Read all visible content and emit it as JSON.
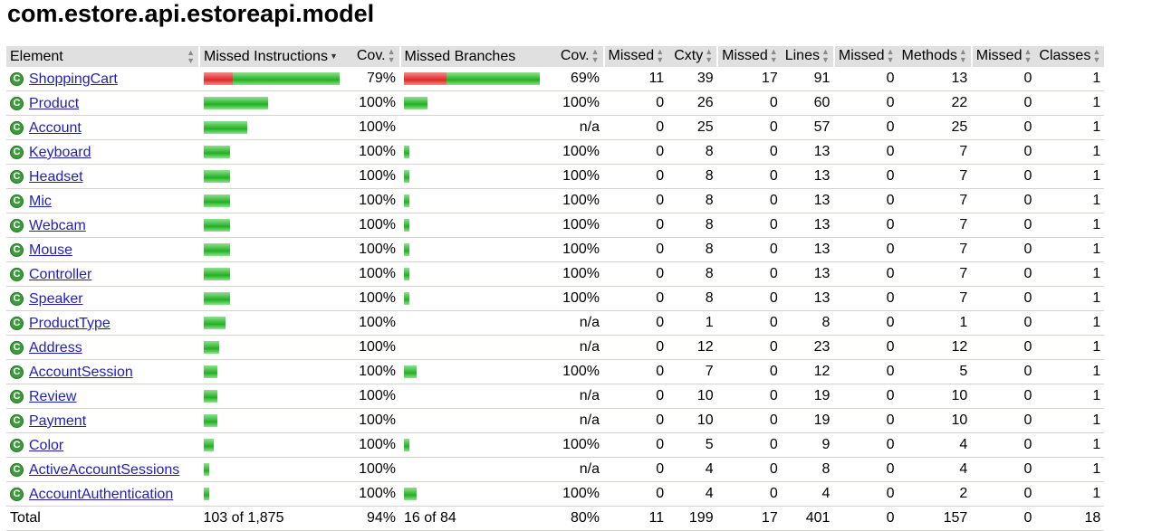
{
  "title": "com.estore.api.estoreapi.model",
  "headers": {
    "element": "Element",
    "missed_instructions": "Missed Instructions",
    "cov1": "Cov.",
    "missed_branches": "Missed Branches",
    "cov2": "Cov.",
    "missed_cxty": "Missed",
    "cxty": "Cxty",
    "missed_lines": "Missed",
    "lines": "Lines",
    "missed_methods": "Missed",
    "methods": "Methods",
    "missed_classes": "Missed",
    "classes": "Classes"
  },
  "colors": {
    "missed_bar": "#e02828",
    "covered_bar": "#22b022",
    "header_bg": "#e0e0e0",
    "class_icon": "#3d9a3d"
  },
  "rows": [
    {
      "name": "ShoppingCart",
      "instr_missed_frac": 0.21,
      "instr_covered_frac": 0.79,
      "instr_total": 1.0,
      "cov1": "79%",
      "br_missed_frac": 0.31,
      "br_covered_frac": 0.69,
      "br_total": 1.0,
      "cov2": "69%",
      "missed_cxty": "11",
      "cxty": "39",
      "missed_lines": "17",
      "lines": "91",
      "missed_methods": "0",
      "methods": "13",
      "missed_classes": "0",
      "classes": "1"
    },
    {
      "name": "Product",
      "instr_missed_frac": 0,
      "instr_covered_frac": 1,
      "instr_total": 0.47,
      "cov1": "100%",
      "br_missed_frac": 0,
      "br_covered_frac": 1,
      "br_total": 0.17,
      "cov2": "100%",
      "missed_cxty": "0",
      "cxty": "26",
      "missed_lines": "0",
      "lines": "60",
      "missed_methods": "0",
      "methods": "22",
      "missed_classes": "0",
      "classes": "1"
    },
    {
      "name": "Account",
      "instr_missed_frac": 0,
      "instr_covered_frac": 1,
      "instr_total": 0.32,
      "cov1": "100%",
      "br_missed_frac": 0,
      "br_covered_frac": 0,
      "br_total": 0,
      "cov2": "n/a",
      "missed_cxty": "0",
      "cxty": "25",
      "missed_lines": "0",
      "lines": "57",
      "missed_methods": "0",
      "methods": "25",
      "missed_classes": "0",
      "classes": "1"
    },
    {
      "name": "Keyboard",
      "instr_missed_frac": 0,
      "instr_covered_frac": 1,
      "instr_total": 0.19,
      "cov1": "100%",
      "br_missed_frac": 0,
      "br_covered_frac": 1,
      "br_total": 0.04,
      "cov2": "100%",
      "missed_cxty": "0",
      "cxty": "8",
      "missed_lines": "0",
      "lines": "13",
      "missed_methods": "0",
      "methods": "7",
      "missed_classes": "0",
      "classes": "1"
    },
    {
      "name": "Headset",
      "instr_missed_frac": 0,
      "instr_covered_frac": 1,
      "instr_total": 0.19,
      "cov1": "100%",
      "br_missed_frac": 0,
      "br_covered_frac": 1,
      "br_total": 0.04,
      "cov2": "100%",
      "missed_cxty": "0",
      "cxty": "8",
      "missed_lines": "0",
      "lines": "13",
      "missed_methods": "0",
      "methods": "7",
      "missed_classes": "0",
      "classes": "1"
    },
    {
      "name": "Mic",
      "instr_missed_frac": 0,
      "instr_covered_frac": 1,
      "instr_total": 0.19,
      "cov1": "100%",
      "br_missed_frac": 0,
      "br_covered_frac": 1,
      "br_total": 0.04,
      "cov2": "100%",
      "missed_cxty": "0",
      "cxty": "8",
      "missed_lines": "0",
      "lines": "13",
      "missed_methods": "0",
      "methods": "7",
      "missed_classes": "0",
      "classes": "1"
    },
    {
      "name": "Webcam",
      "instr_missed_frac": 0,
      "instr_covered_frac": 1,
      "instr_total": 0.19,
      "cov1": "100%",
      "br_missed_frac": 0,
      "br_covered_frac": 1,
      "br_total": 0.04,
      "cov2": "100%",
      "missed_cxty": "0",
      "cxty": "8",
      "missed_lines": "0",
      "lines": "13",
      "missed_methods": "0",
      "methods": "7",
      "missed_classes": "0",
      "classes": "1"
    },
    {
      "name": "Mouse",
      "instr_missed_frac": 0,
      "instr_covered_frac": 1,
      "instr_total": 0.19,
      "cov1": "100%",
      "br_missed_frac": 0,
      "br_covered_frac": 1,
      "br_total": 0.04,
      "cov2": "100%",
      "missed_cxty": "0",
      "cxty": "8",
      "missed_lines": "0",
      "lines": "13",
      "missed_methods": "0",
      "methods": "7",
      "missed_classes": "0",
      "classes": "1"
    },
    {
      "name": "Controller",
      "instr_missed_frac": 0,
      "instr_covered_frac": 1,
      "instr_total": 0.19,
      "cov1": "100%",
      "br_missed_frac": 0,
      "br_covered_frac": 1,
      "br_total": 0.04,
      "cov2": "100%",
      "missed_cxty": "0",
      "cxty": "8",
      "missed_lines": "0",
      "lines": "13",
      "missed_methods": "0",
      "methods": "7",
      "missed_classes": "0",
      "classes": "1"
    },
    {
      "name": "Speaker",
      "instr_missed_frac": 0,
      "instr_covered_frac": 1,
      "instr_total": 0.19,
      "cov1": "100%",
      "br_missed_frac": 0,
      "br_covered_frac": 1,
      "br_total": 0.04,
      "cov2": "100%",
      "missed_cxty": "0",
      "cxty": "8",
      "missed_lines": "0",
      "lines": "13",
      "missed_methods": "0",
      "methods": "7",
      "missed_classes": "0",
      "classes": "1"
    },
    {
      "name": "ProductType",
      "instr_missed_frac": 0,
      "instr_covered_frac": 1,
      "instr_total": 0.16,
      "cov1": "100%",
      "br_missed_frac": 0,
      "br_covered_frac": 0,
      "br_total": 0,
      "cov2": "n/a",
      "missed_cxty": "0",
      "cxty": "1",
      "missed_lines": "0",
      "lines": "8",
      "missed_methods": "0",
      "methods": "1",
      "missed_classes": "0",
      "classes": "1"
    },
    {
      "name": "Address",
      "instr_missed_frac": 0,
      "instr_covered_frac": 1,
      "instr_total": 0.11,
      "cov1": "100%",
      "br_missed_frac": 0,
      "br_covered_frac": 0,
      "br_total": 0,
      "cov2": "n/a",
      "missed_cxty": "0",
      "cxty": "12",
      "missed_lines": "0",
      "lines": "23",
      "missed_methods": "0",
      "methods": "12",
      "missed_classes": "0",
      "classes": "1"
    },
    {
      "name": "AccountSession",
      "instr_missed_frac": 0,
      "instr_covered_frac": 1,
      "instr_total": 0.1,
      "cov1": "100%",
      "br_missed_frac": 0,
      "br_covered_frac": 1,
      "br_total": 0.09,
      "cov2": "100%",
      "missed_cxty": "0",
      "cxty": "7",
      "missed_lines": "0",
      "lines": "12",
      "missed_methods": "0",
      "methods": "5",
      "missed_classes": "0",
      "classes": "1"
    },
    {
      "name": "Review",
      "instr_missed_frac": 0,
      "instr_covered_frac": 1,
      "instr_total": 0.1,
      "cov1": "100%",
      "br_missed_frac": 0,
      "br_covered_frac": 0,
      "br_total": 0,
      "cov2": "n/a",
      "missed_cxty": "0",
      "cxty": "10",
      "missed_lines": "0",
      "lines": "19",
      "missed_methods": "0",
      "methods": "10",
      "missed_classes": "0",
      "classes": "1"
    },
    {
      "name": "Payment",
      "instr_missed_frac": 0,
      "instr_covered_frac": 1,
      "instr_total": 0.1,
      "cov1": "100%",
      "br_missed_frac": 0,
      "br_covered_frac": 0,
      "br_total": 0,
      "cov2": "n/a",
      "missed_cxty": "0",
      "cxty": "10",
      "missed_lines": "0",
      "lines": "19",
      "missed_methods": "0",
      "methods": "10",
      "missed_classes": "0",
      "classes": "1"
    },
    {
      "name": "Color",
      "instr_missed_frac": 0,
      "instr_covered_frac": 1,
      "instr_total": 0.07,
      "cov1": "100%",
      "br_missed_frac": 0,
      "br_covered_frac": 1,
      "br_total": 0.04,
      "cov2": "100%",
      "missed_cxty": "0",
      "cxty": "5",
      "missed_lines": "0",
      "lines": "9",
      "missed_methods": "0",
      "methods": "4",
      "missed_classes": "0",
      "classes": "1"
    },
    {
      "name": "ActiveAccountSessions",
      "instr_missed_frac": 0,
      "instr_covered_frac": 1,
      "instr_total": 0.04,
      "cov1": "100%",
      "br_missed_frac": 0,
      "br_covered_frac": 0,
      "br_total": 0,
      "cov2": "n/a",
      "missed_cxty": "0",
      "cxty": "4",
      "missed_lines": "0",
      "lines": "8",
      "missed_methods": "0",
      "methods": "4",
      "missed_classes": "0",
      "classes": "1"
    },
    {
      "name": "AccountAuthentication",
      "instr_missed_frac": 0,
      "instr_covered_frac": 1,
      "instr_total": 0.04,
      "cov1": "100%",
      "br_missed_frac": 0,
      "br_covered_frac": 1,
      "br_total": 0.09,
      "cov2": "100%",
      "missed_cxty": "0",
      "cxty": "4",
      "missed_lines": "0",
      "lines": "4",
      "missed_methods": "0",
      "methods": "2",
      "missed_classes": "0",
      "classes": "1"
    }
  ],
  "total": {
    "label": "Total",
    "instructions": "103 of 1,875",
    "cov1": "94%",
    "branches": "16 of 84",
    "cov2": "80%",
    "missed_cxty": "11",
    "cxty": "199",
    "missed_lines": "17",
    "lines": "401",
    "missed_methods": "0",
    "methods": "157",
    "missed_classes": "0",
    "classes": "18"
  }
}
